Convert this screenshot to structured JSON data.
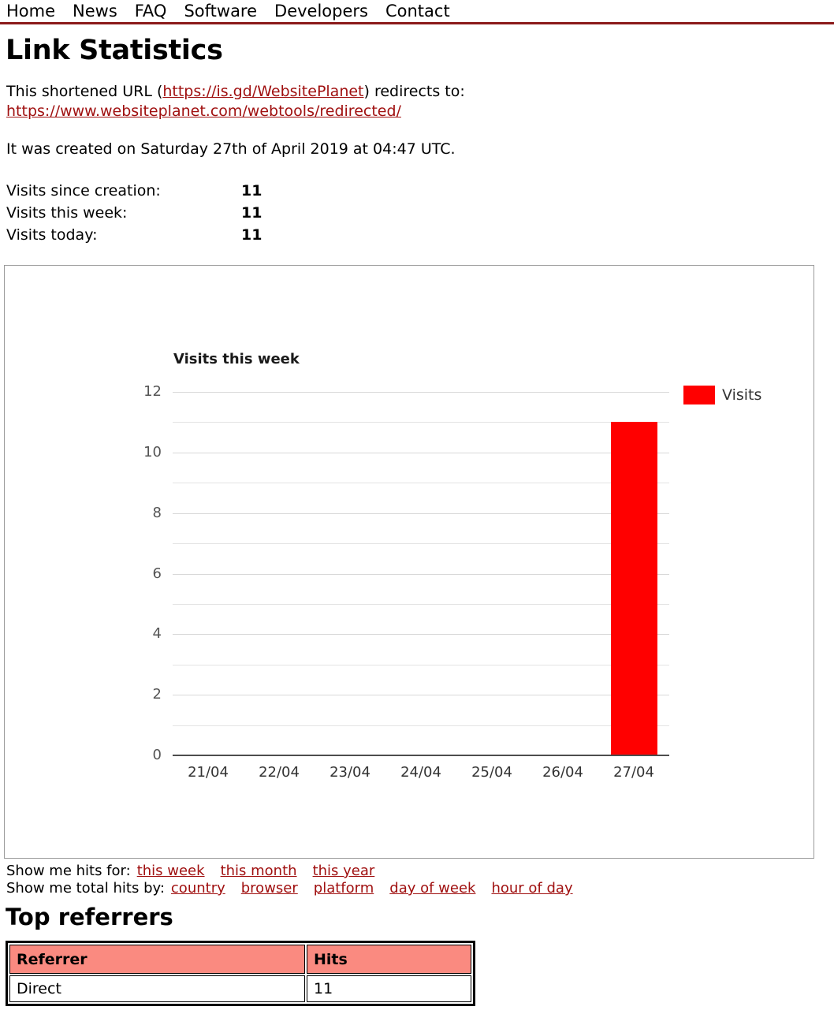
{
  "nav": {
    "items": [
      {
        "label": "Home"
      },
      {
        "label": "News"
      },
      {
        "label": "FAQ"
      },
      {
        "label": "Software"
      },
      {
        "label": "Developers"
      },
      {
        "label": "Contact"
      }
    ]
  },
  "page": {
    "title": "Link Statistics",
    "intro_prefix": "This shortened URL (",
    "short_url": "https://is.gd/WebsitePlanet",
    "intro_suffix": ") redirects to:",
    "target_url": "https://www.websiteplanet.com/webtools/redirected/",
    "created_text": "It was created on Saturday 27th of April 2019 at 04:47 UTC."
  },
  "counters": [
    {
      "label": "Visits since creation:",
      "value": "11"
    },
    {
      "label": "Visits this week:",
      "value": "11"
    },
    {
      "label": "Visits today:",
      "value": "11"
    }
  ],
  "chart_data": {
    "type": "bar",
    "title": "Visits this week",
    "xlabel": "",
    "ylabel": "",
    "categories": [
      "21/04",
      "22/04",
      "23/04",
      "24/04",
      "25/04",
      "26/04",
      "27/04"
    ],
    "values": [
      0,
      0,
      0,
      0,
      0,
      0,
      11
    ],
    "series": [
      {
        "name": "Visits",
        "values": [
          0,
          0,
          0,
          0,
          0,
          0,
          11
        ],
        "color": "#ff0000"
      }
    ],
    "ylim": [
      0,
      12
    ],
    "yticks": [
      "12",
      "10",
      "8",
      "6",
      "4",
      "2",
      "0"
    ],
    "ytick_values": [
      12,
      10,
      8,
      6,
      4,
      2,
      0
    ],
    "minor_gridlines": [
      11,
      9,
      7,
      5,
      3,
      1
    ],
    "grid": true,
    "legend": {
      "position": "right",
      "entries": [
        "Visits"
      ]
    }
  },
  "hits_links": {
    "for_label": "Show me hits for:",
    "for_items": [
      {
        "label": "this week"
      },
      {
        "label": "this month"
      },
      {
        "label": "this year"
      }
    ],
    "by_label": "Show me total hits by:",
    "by_items": [
      {
        "label": "country"
      },
      {
        "label": "browser"
      },
      {
        "label": "platform"
      },
      {
        "label": "day of week"
      },
      {
        "label": "hour of day"
      }
    ]
  },
  "referrers": {
    "title": "Top referrers",
    "columns": [
      "Referrer",
      "Hits"
    ],
    "rows": [
      {
        "referrer": "Direct",
        "hits": "11"
      }
    ]
  },
  "colors": {
    "accent_red": "#8b1a1a",
    "link_red": "#a01010",
    "bar_red": "#ff0000",
    "table_header_pink": "#fa8a80"
  }
}
